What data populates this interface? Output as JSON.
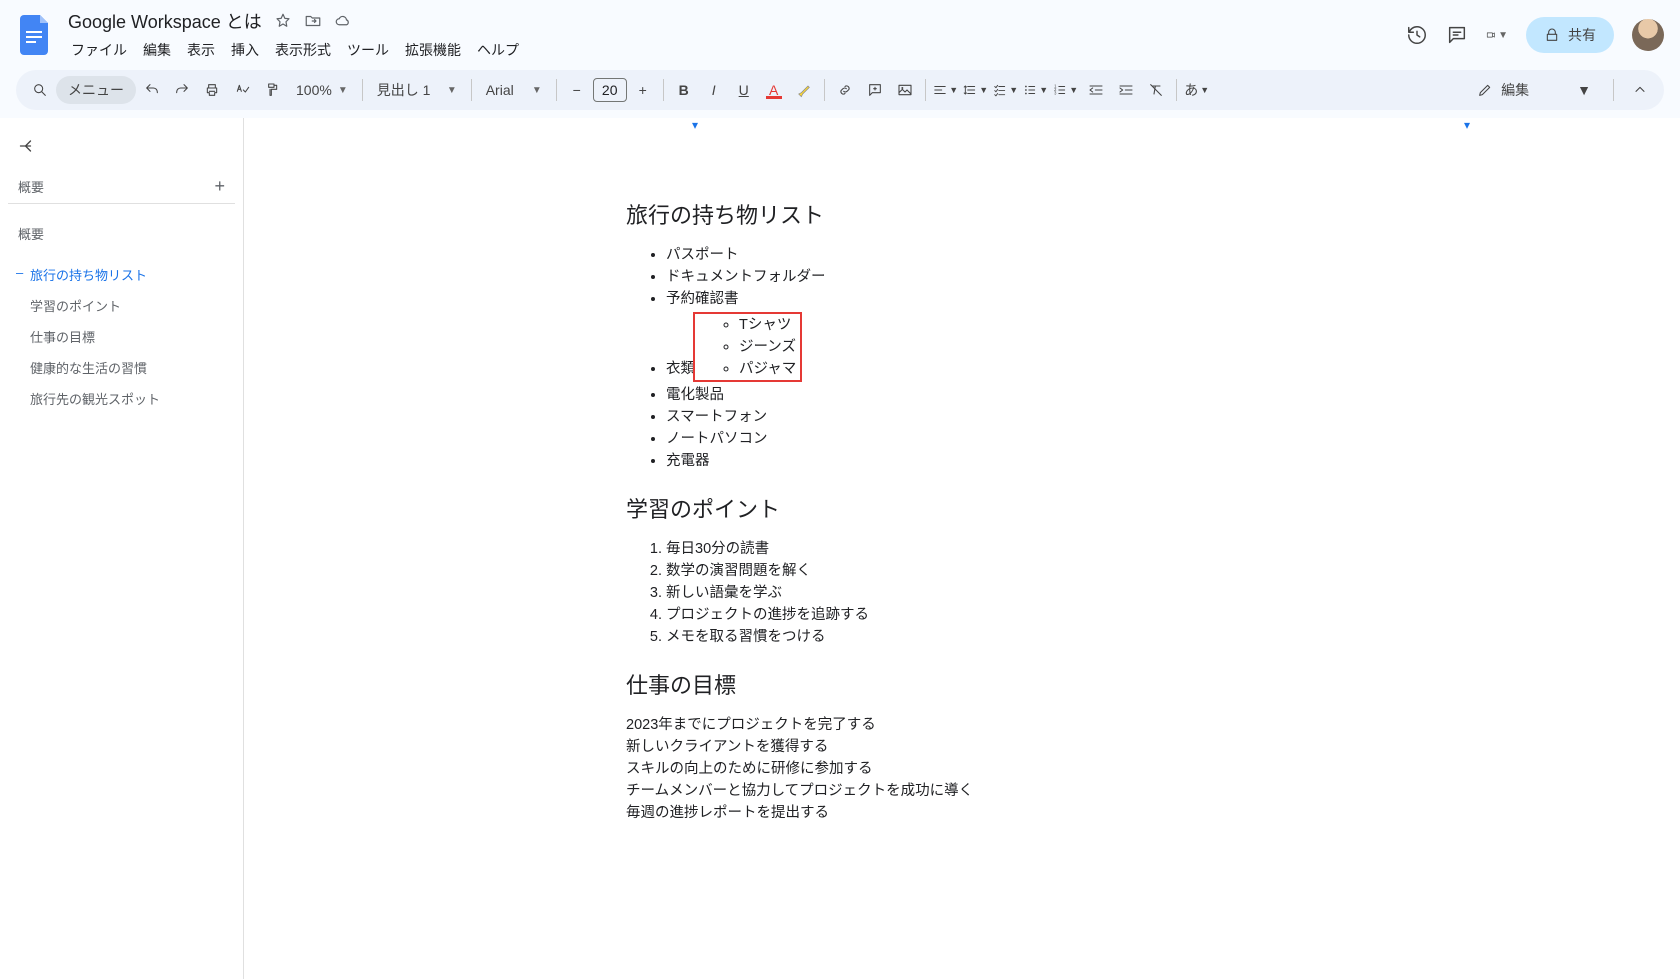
{
  "header": {
    "doc_title": "Google Workspace とは",
    "menus": [
      "ファイル",
      "編集",
      "表示",
      "挿入",
      "表示形式",
      "ツール",
      "拡張機能",
      "ヘルプ"
    ],
    "share_label": "共有"
  },
  "toolbar": {
    "menu_pill": "メニュー",
    "zoom": "100%",
    "style": "見出し 1",
    "font": "Arial",
    "font_size": "20",
    "edit_mode": "編集",
    "ime": "あ"
  },
  "outline": {
    "header": "概要",
    "summary": "概要",
    "items": [
      {
        "label": "旅行の持ち物リスト",
        "active": true
      },
      {
        "label": "学習のポイント",
        "active": false
      },
      {
        "label": "仕事の目標",
        "active": false
      },
      {
        "label": "健康的な生活の習慣",
        "active": false
      },
      {
        "label": "旅行先の観光スポット",
        "active": false
      }
    ]
  },
  "document": {
    "section1": {
      "title": "旅行の持ち物リスト",
      "items_before": [
        "パスポート",
        "ドキュメントフォルダー",
        "予約確認書",
        "衣類"
      ],
      "sub_items": [
        "Tシャツ",
        "ジーンズ",
        "パジャマ"
      ],
      "items_after": [
        "電化製品",
        "スマートフォン",
        "ノートパソコン",
        "充電器"
      ]
    },
    "section2": {
      "title": "学習のポイント",
      "items": [
        "毎日30分の読書",
        "数学の演習問題を解く",
        "新しい語彙を学ぶ",
        "プロジェクトの進捗を追跡する",
        "メモを取る習慣をつける"
      ]
    },
    "section3": {
      "title": "仕事の目標",
      "lines": [
        "2023年までにプロジェクトを完了する",
        "新しいクライアントを獲得する",
        "スキルの向上のために研修に参加する",
        "チームメンバーと協力してプロジェクトを成功に導く",
        "毎週の進捗レポートを提出する"
      ]
    }
  }
}
